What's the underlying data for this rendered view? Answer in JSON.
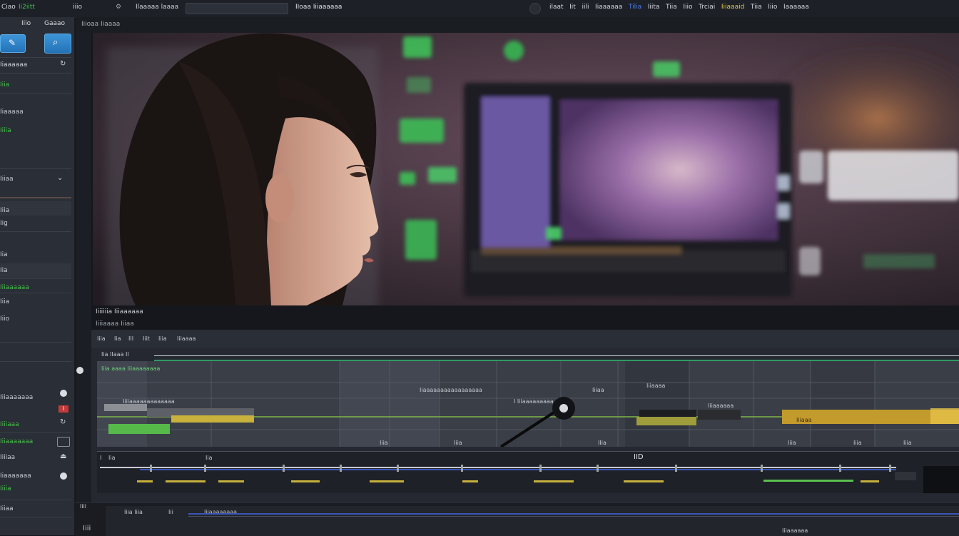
{
  "topbar": {
    "app_title": "Ciao",
    "status_text": "Ii2iitt",
    "menu1": "iiio",
    "menu2": "Ilaaaaa laaaa",
    "center_title": "IIoaa Iiiaaaaaa",
    "right_items": [
      "ilaat",
      "Iit",
      "iili",
      "Iiaaaaaa",
      "Tilia",
      "Iiita",
      "Tiia",
      "Iiio",
      "Trciai",
      "Iiiaaaid",
      "Tiia",
      "Iiio",
      "Iaaaaaa"
    ]
  },
  "sidebar": {
    "tab1": "Iiio",
    "tab2": "Gaaao",
    "section_title": "Iiaaaaaa",
    "item_green1": "Iiia",
    "item2": "Iiaaaaa",
    "item_green2": "Iiiia",
    "dropdown_label": "Iiiaa",
    "rows": [
      "Iiia",
      "Iig",
      "Iia",
      "Iia"
    ],
    "item_green3": "Iiiaaaaaa",
    "rows2": [
      "Iiia",
      "Iiio"
    ],
    "lower_items": [
      "Iiiaaaaaaa",
      "Iiiiaa",
      "Iii",
      "Iiaaaaaaa",
      "Iiiaaaaaaaa",
      "Iiiaaa",
      "Iiiaa"
    ],
    "lower_green": [
      "Iiiiaaa",
      "Iiiaaaaaaa",
      "Iiiia"
    ],
    "badge_red": "I",
    "colors": {
      "accent_blue": "#2b86cf",
      "accent_green": "#45c14a",
      "panel_bg": "#2a2e36"
    }
  },
  "viewer": {
    "header_label": "Iiioaa Iiaaaa",
    "caption1": "Iiiiiiia Iiiaaaaaa",
    "caption2": "Iiiiaaaa Iiiaa"
  },
  "timeline": {
    "toolbar_items": [
      "Iiia",
      "Iia",
      "III",
      "Iiit",
      "Iiia",
      "Iiiaaaa"
    ],
    "ruler_label": "Iia IIaaa II",
    "track_label": "Iiia aaaa Iiiaaaaaaaa",
    "clip_labels": [
      "Iiaaaaaaaaaaaaaaaaa",
      "Iiiaa",
      "Iiiiaaaaaaaaaaaaa",
      "I Iiiaaaaaaaaa",
      "Iiiaaaa",
      "Iiiaaaaaa",
      "Iiiaaa"
    ],
    "time_labels": [
      "Iiia",
      "Iiia",
      "IIia",
      "Iiia",
      "Iiia",
      "Iiia",
      "Iiia"
    ],
    "lower_labels": [
      "I",
      "Iia",
      "Iia",
      "IID"
    ],
    "bottom_labels": [
      "Iiii",
      "Iiia Iiia",
      "Iii",
      "Iiiaaaaaaaa",
      "Iiiaaaaaa"
    ],
    "clip_colors": {
      "green": "#56b94a",
      "yellow": "#c8b13c",
      "gold": "#c39a2c",
      "blue": "#3b56b6"
    }
  }
}
